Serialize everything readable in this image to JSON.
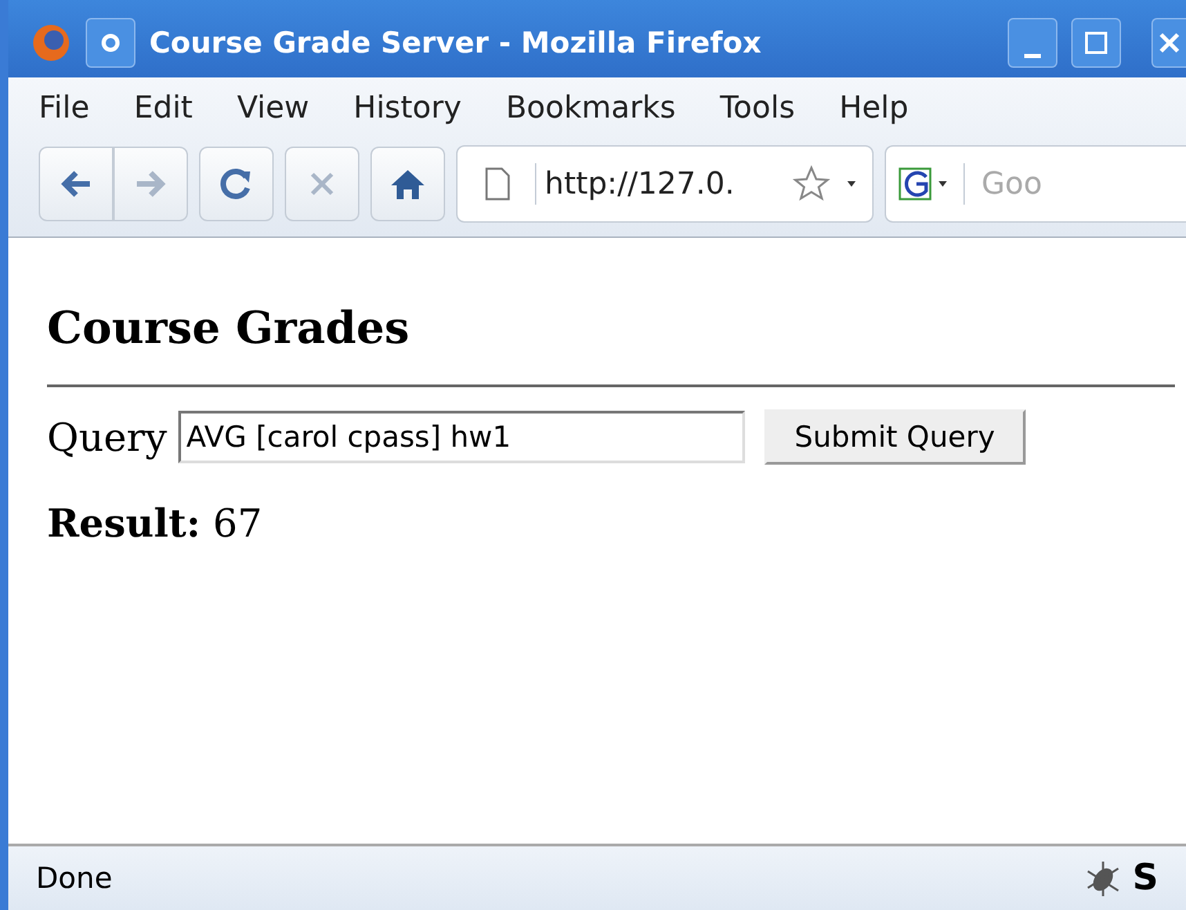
{
  "window": {
    "title": "Course Grade Server - Mozilla Firefox"
  },
  "menu": [
    "File",
    "Edit",
    "View",
    "History",
    "Bookmarks",
    "Tools",
    "Help"
  ],
  "toolbar": {
    "url": "http://127.0.",
    "search_placeholder": "Goo",
    "back_disabled": false,
    "forward_disabled": true,
    "stop_disabled": true
  },
  "page": {
    "heading": "Course Grades",
    "query_label": "Query",
    "query_value": "AVG [carol cpass] hw1",
    "submit": "Submit Query",
    "result_label": "Result:",
    "result_value": "67"
  },
  "status_bar": {
    "text": "Done",
    "badge": "S"
  }
}
